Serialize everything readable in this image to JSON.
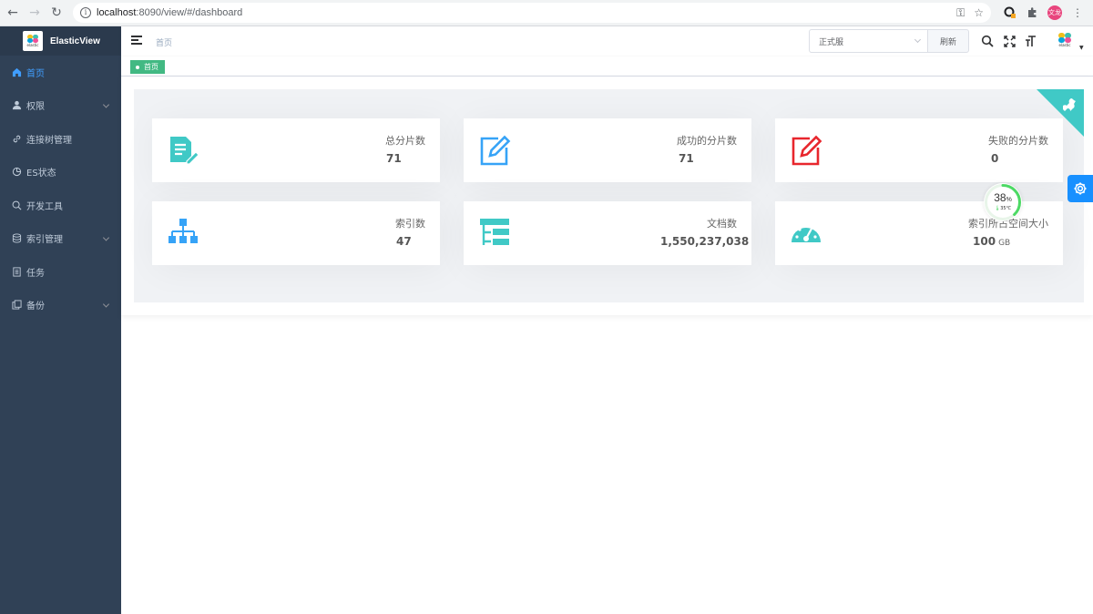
{
  "browser": {
    "url_host": "localhost",
    "url_rest": ":8090/view/#/dashboard",
    "profile_label": "文龙"
  },
  "sidebar": {
    "brand_title": "ElasticView",
    "logo_caption": "elastic",
    "items": [
      {
        "label": "首页",
        "icon": "home-icon",
        "active": true,
        "has_submenu": false
      },
      {
        "label": "权限",
        "icon": "user-icon",
        "active": false,
        "has_submenu": true
      },
      {
        "label": "连接树管理",
        "icon": "link-icon",
        "active": false,
        "has_submenu": false
      },
      {
        "label": "ES状态",
        "icon": "pie-chart-icon",
        "active": false,
        "has_submenu": false
      },
      {
        "label": "开发工具",
        "icon": "search-icon",
        "active": false,
        "has_submenu": false
      },
      {
        "label": "索引管理",
        "icon": "database-icon",
        "active": false,
        "has_submenu": true
      },
      {
        "label": "任务",
        "icon": "document-icon",
        "active": false,
        "has_submenu": false
      },
      {
        "label": "备份",
        "icon": "copy-icon",
        "active": false,
        "has_submenu": true
      }
    ]
  },
  "header": {
    "breadcrumb": "首页",
    "env_select_value": "正式服",
    "refresh_label": "刷新",
    "avatar_caption": "elastic"
  },
  "tags_view": {
    "active_tag": "首页"
  },
  "cards": [
    {
      "label": "总分片数",
      "value": "71",
      "unit": "",
      "icon": "document-edit-icon",
      "color": "#40c9c6"
    },
    {
      "label": "成功的分片数",
      "value": "71",
      "unit": "",
      "icon": "edit-icon",
      "color": "#36a3f7"
    },
    {
      "label": "失败的分片数",
      "value": "0",
      "unit": "",
      "icon": "edit-icon",
      "color": "#f4516c"
    },
    {
      "label": "索引数",
      "value": "47",
      "unit": "",
      "icon": "tree-icon",
      "color": "#36a3f7"
    },
    {
      "label": "文档数",
      "value": "1,550,237,038",
      "unit": "",
      "icon": "tree-table-icon",
      "color": "#40c9c6"
    },
    {
      "label": "索引所占空间大小",
      "value": "100",
      "unit": "GB",
      "icon": "dashboard-gauge-icon",
      "color": "#40c9c6"
    }
  ],
  "perf_widget": {
    "percent": "38",
    "percent_sign": "%",
    "percent_value": 38,
    "temperature": "35℃"
  },
  "colors": {
    "sidebar_bg": "#304156",
    "accent_blue": "#409eff",
    "tag_green": "#42b983",
    "teal": "#40c9c6"
  }
}
